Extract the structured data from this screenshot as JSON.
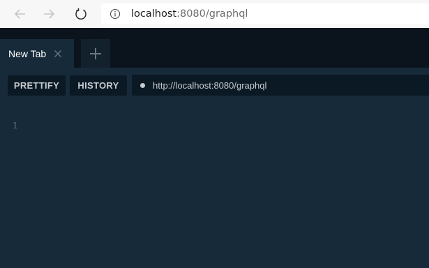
{
  "browser": {
    "url_host": "localhost",
    "url_rest": ":8080/graphql",
    "icons": {
      "back": "arrow-left-icon",
      "forward": "arrow-right-icon",
      "refresh": "refresh-icon",
      "info": "info-icon"
    }
  },
  "app": {
    "tabs": [
      {
        "label": "New Tab",
        "active": true
      }
    ],
    "add_tab_icon": "plus-icon",
    "toolbar": {
      "prettify_label": "PRETTIFY",
      "history_label": "HISTORY",
      "endpoint_url": "http://localhost:8080/graphql"
    },
    "editor": {
      "line_numbers": [
        "1"
      ]
    }
  },
  "colors": {
    "background": "#172a3a",
    "tab_strip": "#0b141d",
    "button_bg": "#0b1924",
    "text_light": "#c5cbd0"
  }
}
